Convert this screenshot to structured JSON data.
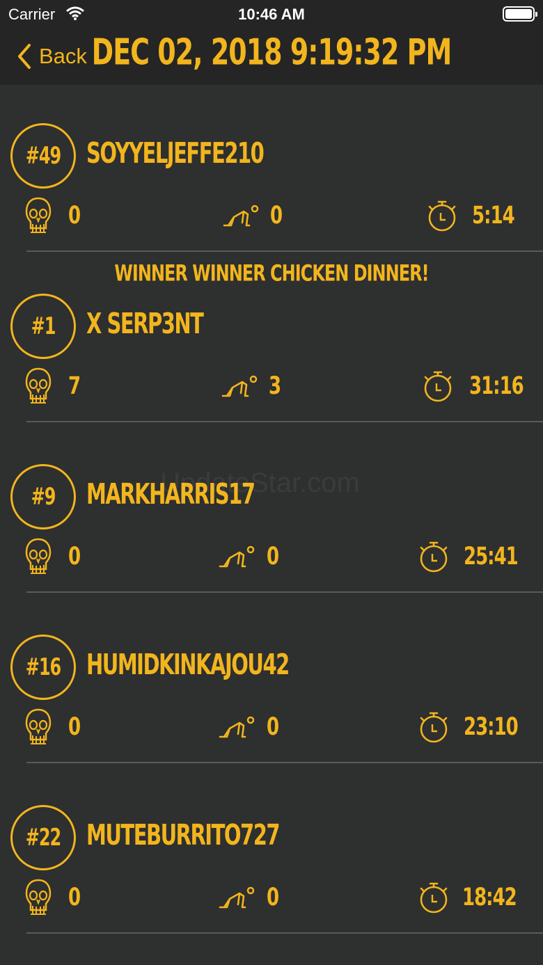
{
  "status_bar": {
    "carrier": "Carrier",
    "time": "10:46 AM"
  },
  "nav": {
    "back_label": "Back",
    "title": "DEC 02, 2018 9:19:32 PM"
  },
  "winner_banner": "WINNER WINNER CHICKEN DINNER!",
  "entries": [
    {
      "rank": "#49",
      "player": "SOYYELJEFFE210",
      "kills": "0",
      "knocks": "0",
      "time": "5:14"
    },
    {
      "rank": "#1",
      "player": "X SERP3NT",
      "kills": "7",
      "knocks": "3",
      "time": "31:16"
    },
    {
      "rank": "#9",
      "player": "MARKHARRIS17",
      "kills": "0",
      "knocks": "0",
      "time": "25:41"
    },
    {
      "rank": "#16",
      "player": "HUMIDKINKAJOU42",
      "kills": "0",
      "knocks": "0",
      "time": "23:10"
    },
    {
      "rank": "#22",
      "player": "MUTEBURRITO727",
      "kills": "0",
      "knocks": "0",
      "time": "18:42"
    }
  ],
  "watermark": "UpdateStar.com",
  "colors": {
    "accent": "#f2b51d",
    "background": "#2e2f2f",
    "bar": "#252525"
  },
  "icons": {
    "kills": "skull-icon",
    "knocks": "crawling-person-icon",
    "time": "stopwatch-icon"
  }
}
